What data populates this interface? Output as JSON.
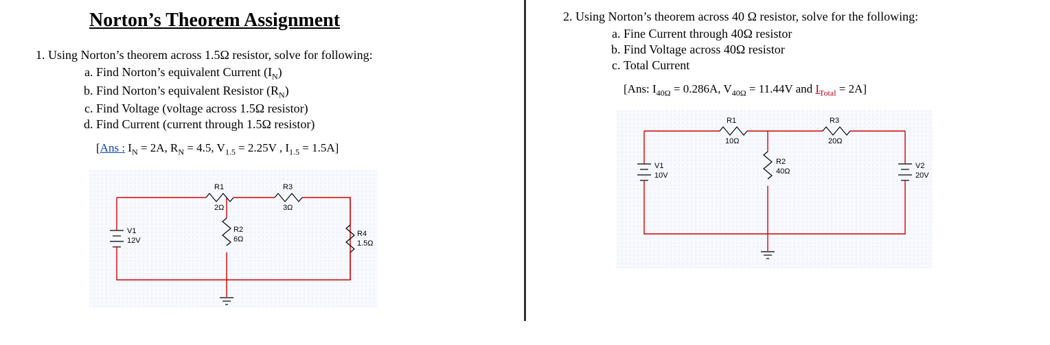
{
  "title": "Norton’s Theorem Assignment",
  "q1": {
    "num": "1.",
    "prompt": "Using Norton’s theorem across 1.5Ω resistor, solve for following:",
    "parts": {
      "a": "Find Norton’s equivalent Current (I",
      "a_sub": "N",
      "a_close": ")",
      "b": "Find Norton’s equivalent Resistor (R",
      "b_sub": "N",
      "b_close": ")",
      "c": "Find Voltage (voltage across 1.5Ω resistor)",
      "d": "Find Current (current through 1.5Ω resistor)"
    },
    "answer_label": "Ans :",
    "answer_rest": " I",
    "answer_full": "N = 2A, R",
    "answer_mid": "N = 4.5, V",
    "answer_mid2": "1.5 = 2.25V , I",
    "answer_end": "1.5 = 1.5A]",
    "circuit": {
      "R1": {
        "label": "R1",
        "value": "2Ω"
      },
      "R2": {
        "label": "R2",
        "value": "6Ω"
      },
      "R3": {
        "label": "R3",
        "value": "3Ω"
      },
      "R4": {
        "label": "R4",
        "value": "1.5Ω"
      },
      "V1": {
        "label": "V1",
        "value": "12V"
      }
    }
  },
  "q2": {
    "num": "2.",
    "prompt": "Using Norton’s theorem across 40 Ω resistor, solve for the following:",
    "parts": {
      "a": "Fine Current through 40Ω resistor",
      "b": "Find Voltage across 40Ω resistor",
      "c": "Total Current"
    },
    "answer_pre": "[Ans: I",
    "answer_s1": "40Ω",
    "answer_m1": " = 0.286A, V",
    "answer_s2": "40Ω",
    "answer_m2": " = 11.44V and ",
    "answer_itotal": "I",
    "answer_itotal_sub": "Total",
    "answer_end": " = 2A]",
    "circuit": {
      "R1": {
        "label": "R1",
        "value": "10Ω"
      },
      "R2": {
        "label": "R2",
        "value": "40Ω"
      },
      "R3": {
        "label": "R3",
        "value": "20Ω"
      },
      "V1": {
        "label": "V1",
        "value": "10V"
      },
      "V2": {
        "label": "V2",
        "value": "20V"
      }
    }
  }
}
